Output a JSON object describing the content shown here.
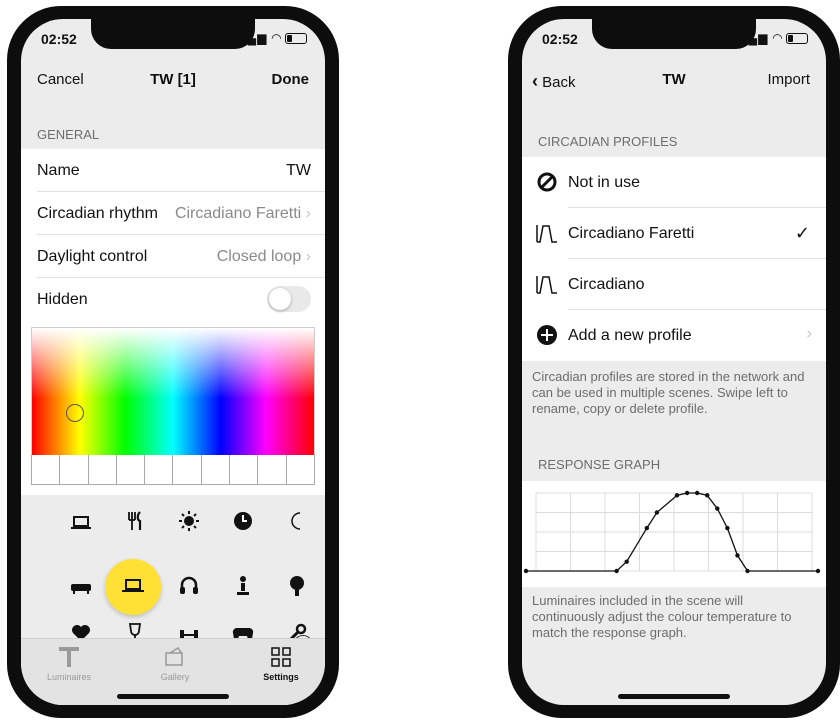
{
  "left_phone": {
    "status": {
      "time": "02:52"
    },
    "nav": {
      "cancel": "Cancel",
      "title": "TW [1]",
      "done": "Done"
    },
    "general": {
      "header": "GENERAL",
      "rows": [
        {
          "label": "Name",
          "value": "TW"
        },
        {
          "label": "Circadian rhythm",
          "value": "Circadiano Faretti"
        },
        {
          "label": "Daylight control",
          "value": "Closed loop"
        },
        {
          "label": "Hidden",
          "toggle": false
        }
      ]
    },
    "icon_grid": {
      "icons": [
        "laptop-icon",
        "cutlery-icon",
        "sun-icon",
        "clock-icon",
        "moon-icon",
        "sofa-icon",
        "laptop-desk-icon",
        "headphones-icon",
        "fountain-icon",
        "tree-icon",
        "heart-icon",
        "wine-glass-icon",
        "dumbbell-icon",
        "gamepad-icon",
        "wrench-icon"
      ],
      "selected": "laptop-desk-icon",
      "selected_color": "#ffe135"
    },
    "tabs": [
      {
        "label": "Luminaires",
        "active": false
      },
      {
        "label": "Gallery",
        "active": false
      },
      {
        "label": "Settings",
        "active": true
      }
    ]
  },
  "right_phone": {
    "status": {
      "time": "02:52"
    },
    "nav": {
      "back": "Back",
      "title": "TW",
      "import": "Import"
    },
    "profiles": {
      "header": "CIRCADIAN PROFILES",
      "items": [
        {
          "label": "Not in use",
          "icon": "prohibited-icon",
          "checked": false
        },
        {
          "label": "Circadiano Faretti",
          "icon": "curve-icon",
          "checked": true
        },
        {
          "label": "Circadiano",
          "icon": "curve-icon",
          "checked": false
        },
        {
          "label": "Add a new profile",
          "icon": "plus-circle-icon",
          "checked": false
        }
      ],
      "footnote": "Circadian profiles are stored in the network and can be used in multiple scenes. Swipe left to rename, copy or delete profile."
    },
    "graph": {
      "header": "RESPONSE GRAPH",
      "footnote": "Luminaires included in the scene will continuously adjust the colour temperature to match the response graph."
    }
  },
  "chart_data": {
    "type": "line",
    "x": [
      0,
      9,
      10,
      12,
      13,
      15,
      16,
      17,
      18,
      19,
      20,
      21,
      22,
      29
    ],
    "y": [
      0,
      0,
      0.12,
      0.55,
      0.75,
      0.97,
      1.0,
      1.0,
      0.97,
      0.8,
      0.55,
      0.2,
      0,
      0
    ]
  }
}
